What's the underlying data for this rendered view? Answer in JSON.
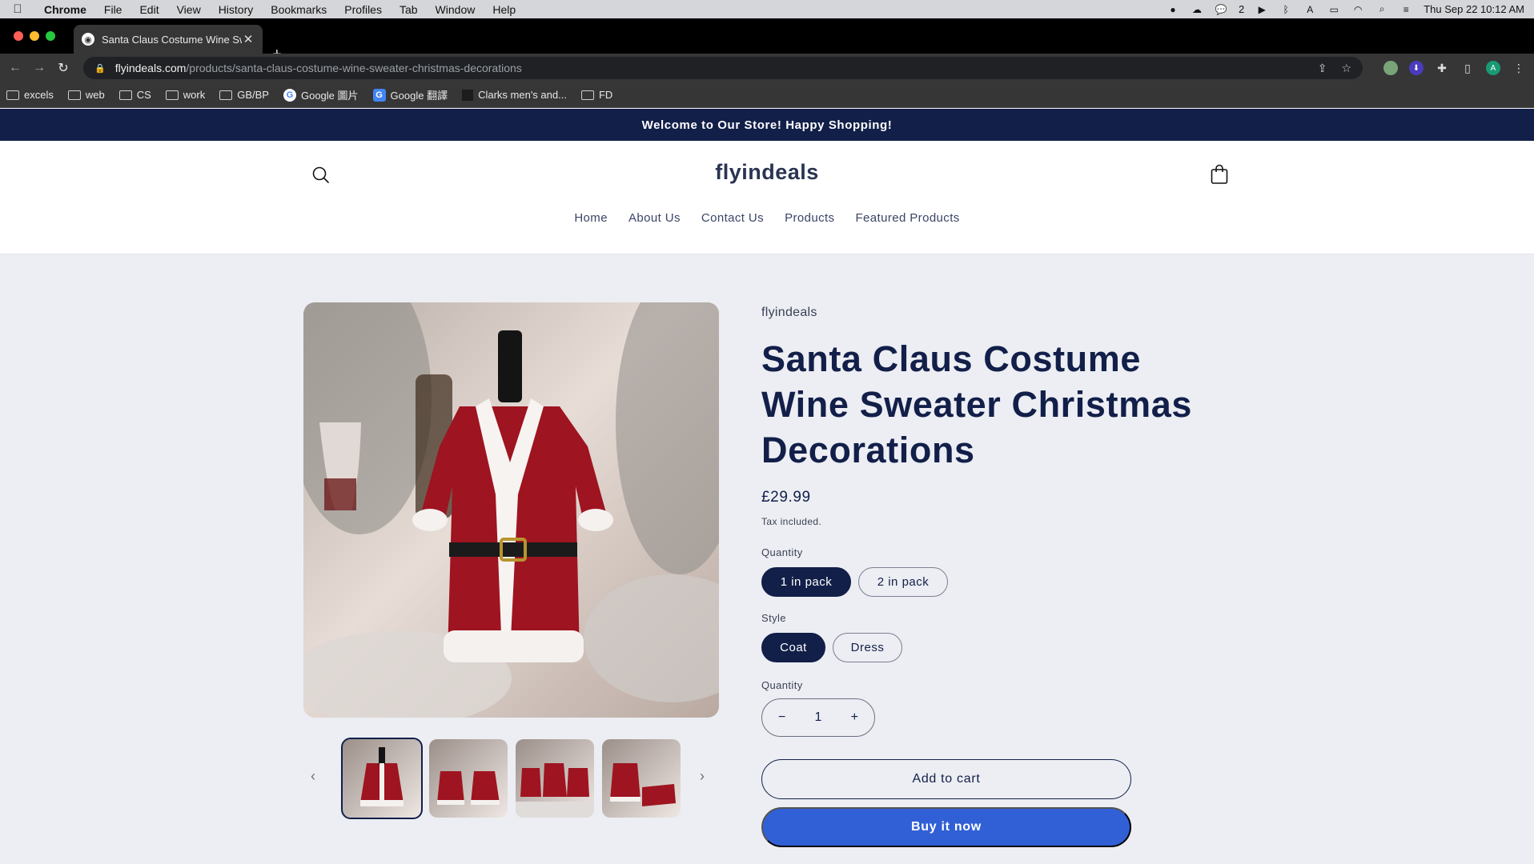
{
  "menubar": {
    "app_name": "Chrome",
    "items": [
      "File",
      "Edit",
      "View",
      "History",
      "Bookmarks",
      "Profiles",
      "Tab",
      "Window",
      "Help"
    ],
    "wechat_count": "2",
    "datetime": "Thu Sep 22  10:12 AM"
  },
  "browser": {
    "tab_title": "Santa Claus Costume Wine Sw",
    "url_host": "flyindeals.com",
    "url_path": "/products/santa-claus-costume-wine-sweater-christmas-decorations",
    "bookmarks": [
      "excels",
      "web",
      "CS",
      "work",
      "GB/BP",
      "Google 圖片",
      "Google 翻譯",
      "Clarks men's and...",
      "FD"
    ]
  },
  "store": {
    "announcement": "Welcome to Our Store! Happy Shopping!",
    "logo": "flyindeals",
    "nav": [
      "Home",
      "About Us",
      "Contact Us",
      "Products",
      "Featured Products"
    ]
  },
  "product": {
    "vendor": "flyindeals",
    "title": "Santa Claus Costume Wine Sweater Christmas Decorations",
    "price": "£29.99",
    "tax_note": "Tax included.",
    "option1_label": "Quantity",
    "option1_values": [
      "1 in pack",
      "2 in pack"
    ],
    "option1_selected": "1 in pack",
    "option2_label": "Style",
    "option2_values": [
      "Coat",
      "Dress"
    ],
    "option2_selected": "Coat",
    "quantity_label": "Quantity",
    "quantity_value": "1",
    "decrease_symbol": "−",
    "increase_symbol": "+",
    "add_to_cart": "Add to cart",
    "buy_now": "Buy it now"
  },
  "colors": {
    "brand_navy": "#121f49",
    "buy_button_blue": "#3160d6",
    "page_background": "#eceef3"
  },
  "icons": [
    "apple-icon",
    "search-icon",
    "cart-icon",
    "back-arrow-icon",
    "forward-arrow-icon",
    "reload-icon",
    "lock-icon",
    "share-icon",
    "star-icon",
    "extensions-icon",
    "folder-icon",
    "chevron-left-icon",
    "chevron-right-icon"
  ]
}
